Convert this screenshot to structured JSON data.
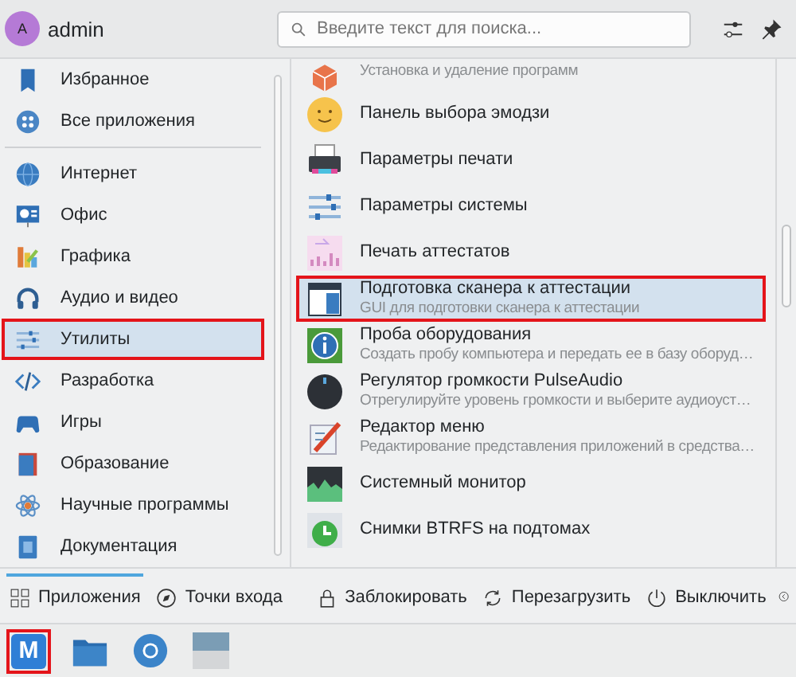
{
  "user": {
    "avatar_letter": "A",
    "name": "admin"
  },
  "search": {
    "placeholder": "Введите текст для поиска..."
  },
  "sidebar": {
    "favorites": [
      {
        "label": "Избранное",
        "selected": false,
        "annotated": false
      },
      {
        "label": "Все приложения",
        "selected": false,
        "annotated": false
      }
    ],
    "categories": [
      {
        "label": "Интернет",
        "selected": false,
        "annotated": false
      },
      {
        "label": "Офис",
        "selected": false,
        "annotated": false
      },
      {
        "label": "Графика",
        "selected": false,
        "annotated": false
      },
      {
        "label": "Аудио и видео",
        "selected": false,
        "annotated": false
      },
      {
        "label": "Утилиты",
        "selected": true,
        "annotated": true
      },
      {
        "label": "Разработка",
        "selected": false,
        "annotated": false
      },
      {
        "label": "Игры",
        "selected": false,
        "annotated": false
      },
      {
        "label": "Образование",
        "selected": false,
        "annotated": false
      },
      {
        "label": "Научные программы",
        "selected": false,
        "annotated": false
      },
      {
        "label": "Документация",
        "selected": false,
        "annotated": false
      }
    ]
  },
  "apps": [
    {
      "description": "Установка и удаление программ",
      "selected": false,
      "annotated": false
    },
    {
      "name": "Панель выбора эмодзи",
      "selected": false,
      "annotated": false
    },
    {
      "name": "Параметры печати",
      "selected": false,
      "annotated": false
    },
    {
      "name": "Параметры системы",
      "selected": false,
      "annotated": false
    },
    {
      "name": "Печать аттестатов",
      "selected": false,
      "annotated": false
    },
    {
      "name": "Подготовка сканера к аттестации",
      "description": "GUI для подготовки сканера к аттестации",
      "selected": true,
      "annotated": true
    },
    {
      "name": "Проба оборудования",
      "description": "Создать пробу компьютера и передать ее в базу оборуд…",
      "selected": false,
      "annotated": false
    },
    {
      "name": "Регулятор громкости PulseAudio",
      "description": "Отрегулируйте уровень громкости и выберите аудиоуст…",
      "selected": false,
      "annotated": false
    },
    {
      "name": "Редактор меню",
      "description": "Редактирование представления приложений в средства…",
      "selected": false,
      "annotated": false
    },
    {
      "name": "Системный монитор",
      "selected": false,
      "annotated": false
    },
    {
      "name": "Снимки BTRFS на подтомах",
      "selected": false,
      "annotated": false
    }
  ],
  "footer": {
    "tabs": [
      {
        "label": "Приложения",
        "selected": true
      },
      {
        "label": "Точки входа",
        "selected": false
      }
    ],
    "actions": [
      "Заблокировать",
      "Перезагрузить",
      "Выключить"
    ]
  },
  "taskbar": [
    {
      "kind": "launcher",
      "label": "M",
      "annotated": true
    },
    {
      "kind": "folder",
      "annotated": false
    },
    {
      "kind": "browser",
      "annotated": false
    },
    {
      "kind": "window",
      "annotated": false
    }
  ]
}
